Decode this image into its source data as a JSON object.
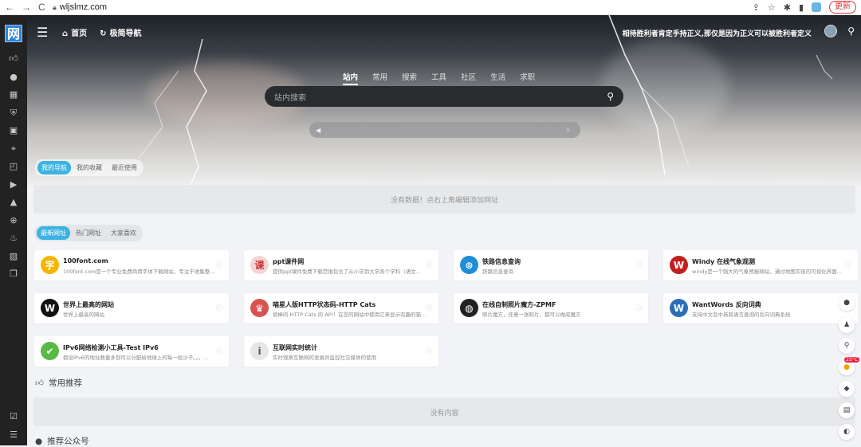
{
  "browser": {
    "url": "wljslmz.com",
    "update_label": "更新"
  },
  "logo": "网",
  "sidebar": {
    "icons": [
      "thumbs-up-icon",
      "wechat-icon",
      "grid-icon",
      "shield-icon",
      "calendar-icon",
      "crosshair-icon",
      "chart-icon",
      "play-icon",
      "graduation-cap-icon",
      "gamepad-icon",
      "lightbulb-icon",
      "image-icon",
      "copy-icon"
    ],
    "bottom_icons": [
      "checklist-icon",
      "list-icon"
    ]
  },
  "topnav": {
    "items": [
      {
        "icon": "home-icon",
        "label": "首页"
      },
      {
        "icon": "refresh-icon",
        "label": "极简导航"
      }
    ],
    "slogan": "相待胜利者肯定手持正义,那仅是因为正义可以被胜利者定义"
  },
  "search": {
    "tabs": [
      "站内",
      "常用",
      "搜索",
      "工具",
      "社区",
      "生活",
      "求职"
    ],
    "placeholder": "站内搜索"
  },
  "mynav": {
    "tabs": [
      "我的导航",
      "我的收藏",
      "最近使用"
    ],
    "empty": "没有数据！点右上角编辑添加网址"
  },
  "latest": {
    "tabs": [
      "最新网址",
      "热门网址",
      "大家喜欢"
    ]
  },
  "cards": [
    {
      "title": "100font.com",
      "desc": "100font.com是一个专业免费商用字体下载网站，专注于收集整...",
      "icon": "字",
      "color": "#f4b400"
    },
    {
      "title": "ppt课件网",
      "desc": "提供ppt课件免费下载范围包含了从小学到大学各个学科（语文...",
      "icon": "课",
      "color": "#f3d5d5"
    },
    {
      "title": "铁路信息查询",
      "desc": "铁路信息查询",
      "icon": "⊚",
      "color": "#1e8fd6"
    },
    {
      "title": "Windy 在线气象观测",
      "desc": "windy是一个强大的气象预报网站，通过地图实现的可视化界面...",
      "icon": "W",
      "color": "#c21e1e"
    },
    {
      "title": "世界上最高的网站",
      "desc": "世界上最高的网站",
      "icon": "W",
      "color": "#111"
    },
    {
      "title": "喵星人版HTTP状态码-HTTP Cats",
      "desc": "很棒的 HTTP Cats 的 API！在您的网站中使用它来显示有趣的猫...",
      "icon": "♛",
      "color": "#d9534f"
    },
    {
      "title": "在线自制照片魔方-ZPMF",
      "desc": "照片魔方，任意一张照片，都可以做成魔方",
      "icon": "◍",
      "color": "#222"
    },
    {
      "title": "WantWords 反向词典",
      "desc": "支持中文及中英跨语言查询的反向词典系统",
      "icon": "W",
      "color": "#2a6fb5"
    },
    {
      "title": "IPv6网络检测小工具-Test IPv6",
      "desc": "假设IPv6的地址数量多到可以分配给地球上的每一粒沙子。。。...",
      "icon": "✔",
      "color": "#58b947"
    },
    {
      "title": "互联网实时统计",
      "desc": "实时观察互联网的发展并监控社交媒体的使用",
      "icon": "i",
      "color": "#e6e6e6"
    }
  ],
  "common": {
    "title": "常用推荐",
    "empty": "没有内容"
  },
  "official": {
    "title": "推荐公众号"
  },
  "weather": {
    "temp": "25°C"
  }
}
